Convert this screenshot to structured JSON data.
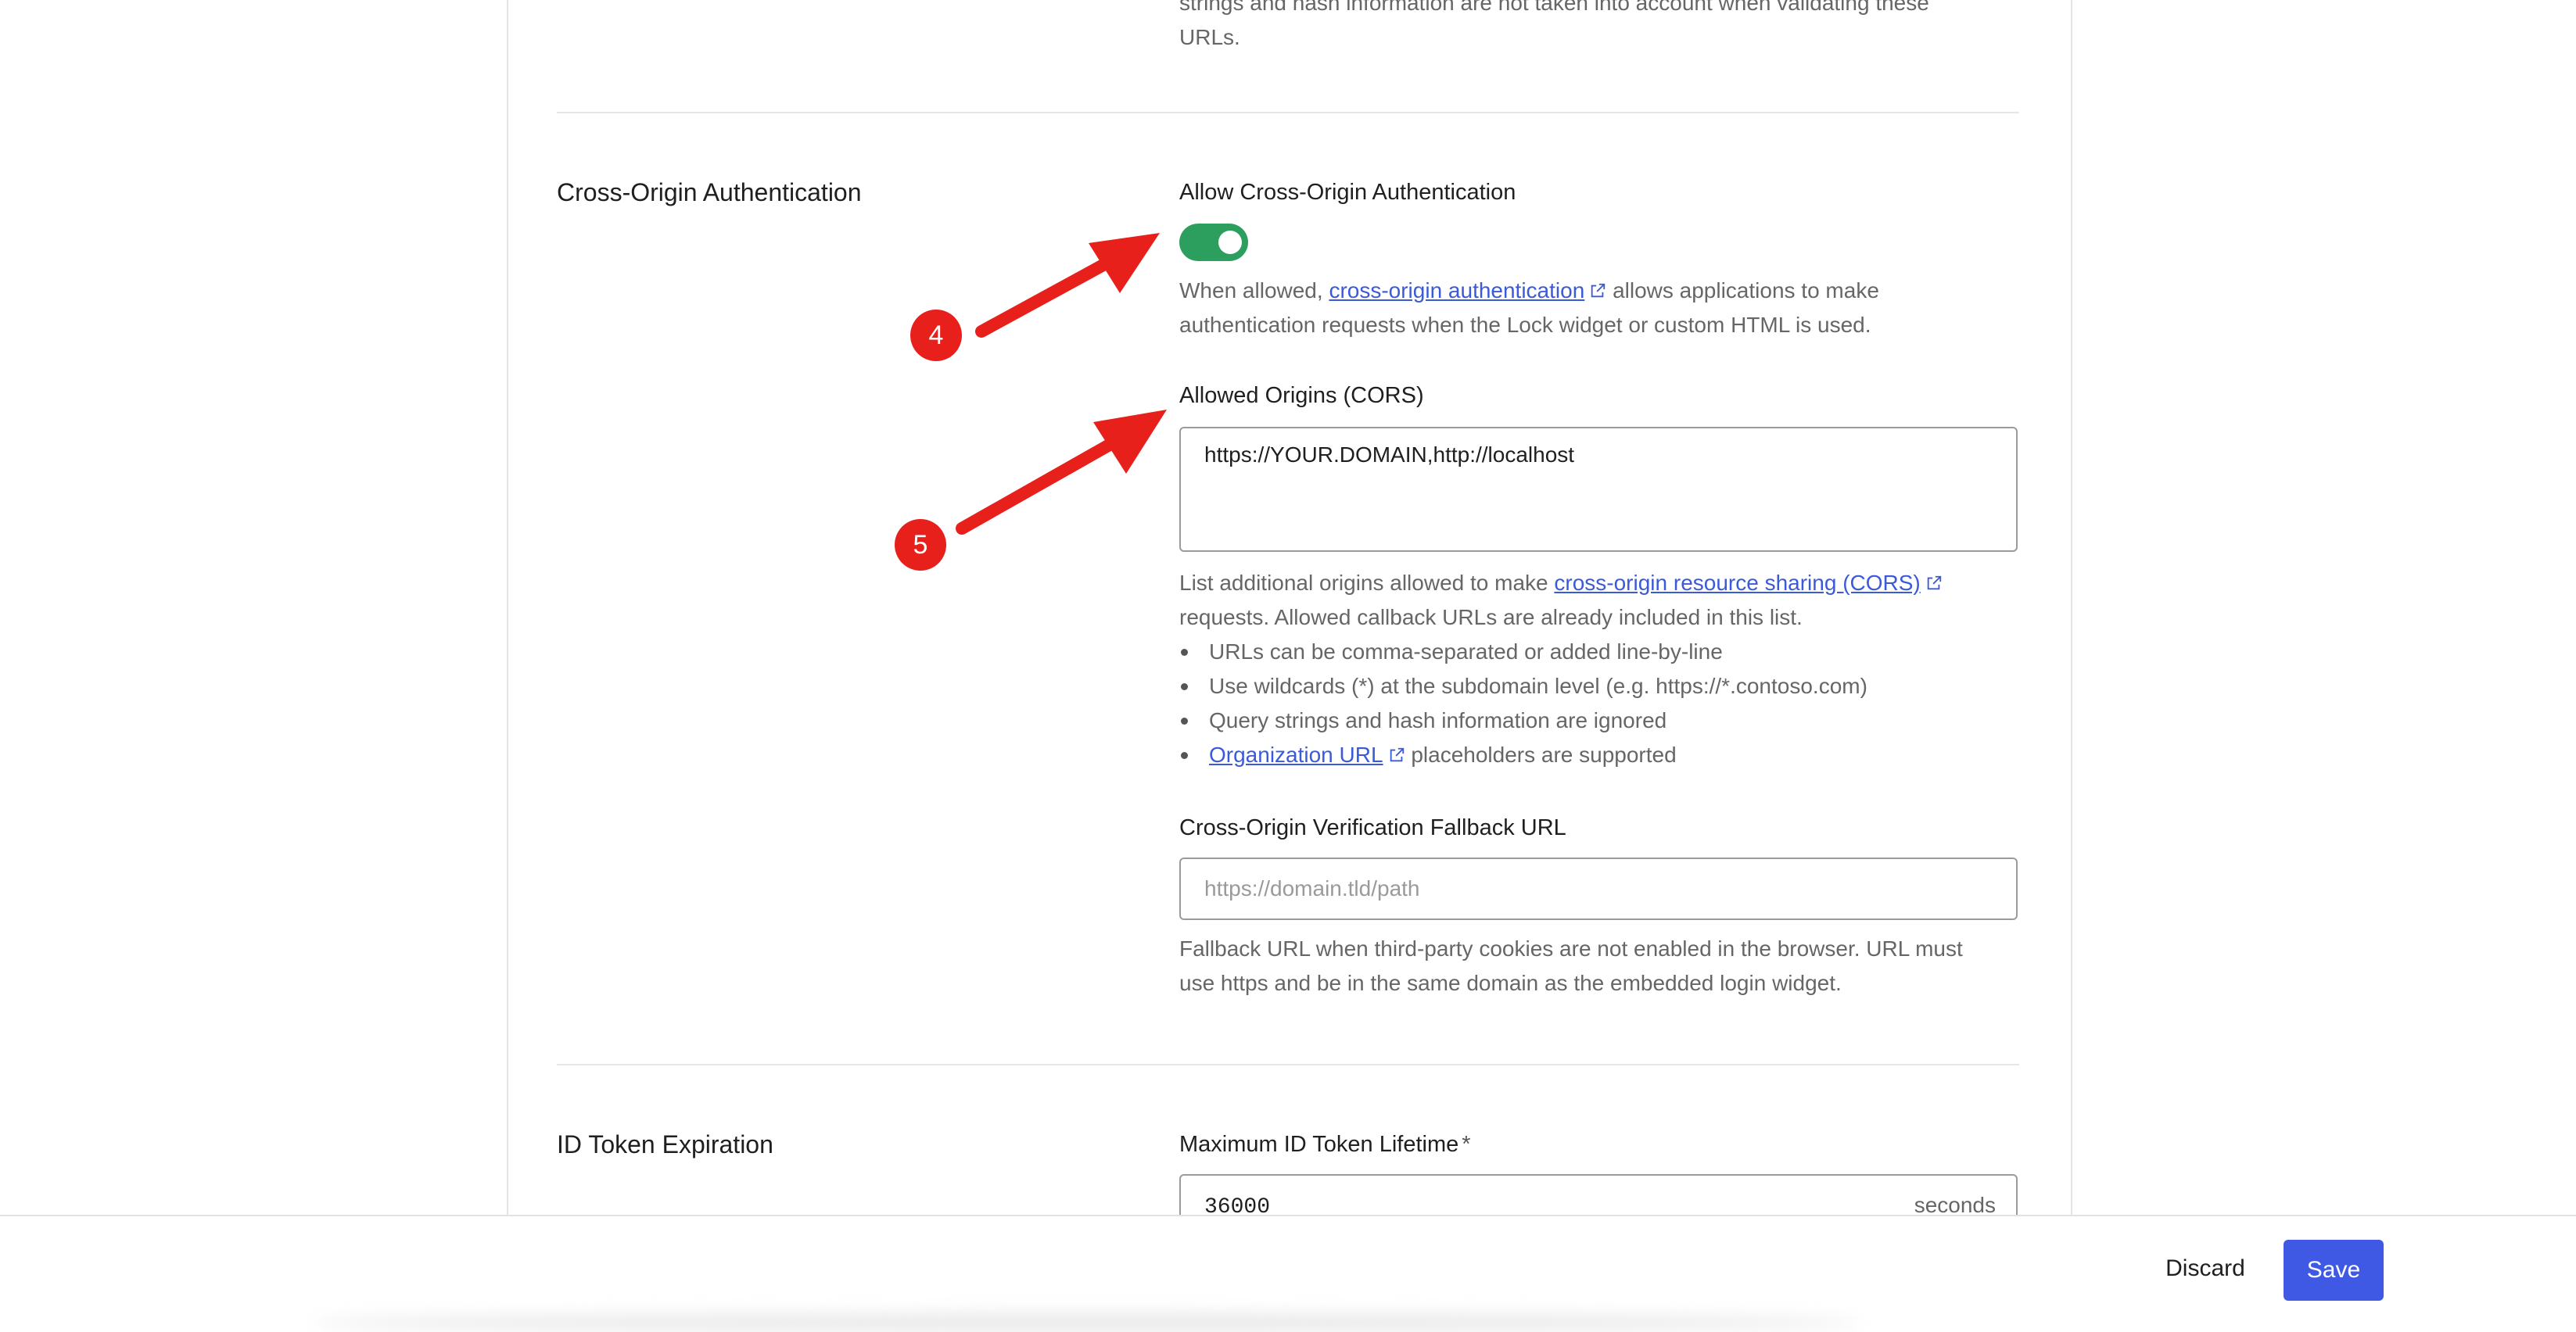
{
  "top_text": {
    "line1": "strings and hash information are not taken into account when validating these",
    "line2": "URLs."
  },
  "cross_origin": {
    "section_title": "Cross-Origin Authentication",
    "allow_label": "Allow Cross-Origin Authentication",
    "toggle_on": true,
    "desc_pre": "When allowed,",
    "desc_link": "cross-origin authentication",
    "desc_post": "allows applications to make",
    "desc_line2": "authentication requests when the Lock widget or custom HTML is used.",
    "origins_label": "Allowed Origins (CORS)",
    "origins_value": "https://YOUR.DOMAIN,http://localhost",
    "origins_help_pre": "List additional origins allowed to make",
    "origins_help_link": "cross-origin resource sharing (CORS)",
    "origins_help_line2": "requests. Allowed callback URLs are already included in this list.",
    "bullets": [
      "URLs can be comma-separated or added line-by-line",
      "Use wildcards (*) at the subdomain level (e.g. https://*.contoso.com)",
      "Query strings and hash information are ignored"
    ],
    "bullet4_link": "Organization URL",
    "bullet4_post": "placeholders are supported",
    "fallback_label": "Cross-Origin Verification Fallback URL",
    "fallback_placeholder": "https://domain.tld/path",
    "fallback_help_line1": "Fallback URL when third-party cookies are not enabled in the browser. URL must",
    "fallback_help_line2": "use https and be in the same domain as the embedded login widget."
  },
  "id_token": {
    "section_title": "ID Token Expiration",
    "lifetime_label": "Maximum ID Token Lifetime",
    "required_mark": "*",
    "lifetime_value": "36000",
    "lifetime_suffix": "seconds"
  },
  "footer": {
    "discard_label": "Discard",
    "save_label": "Save"
  },
  "annotations": {
    "callout_4": "4",
    "callout_5": "5",
    "arrow_color": "#e8201c"
  }
}
